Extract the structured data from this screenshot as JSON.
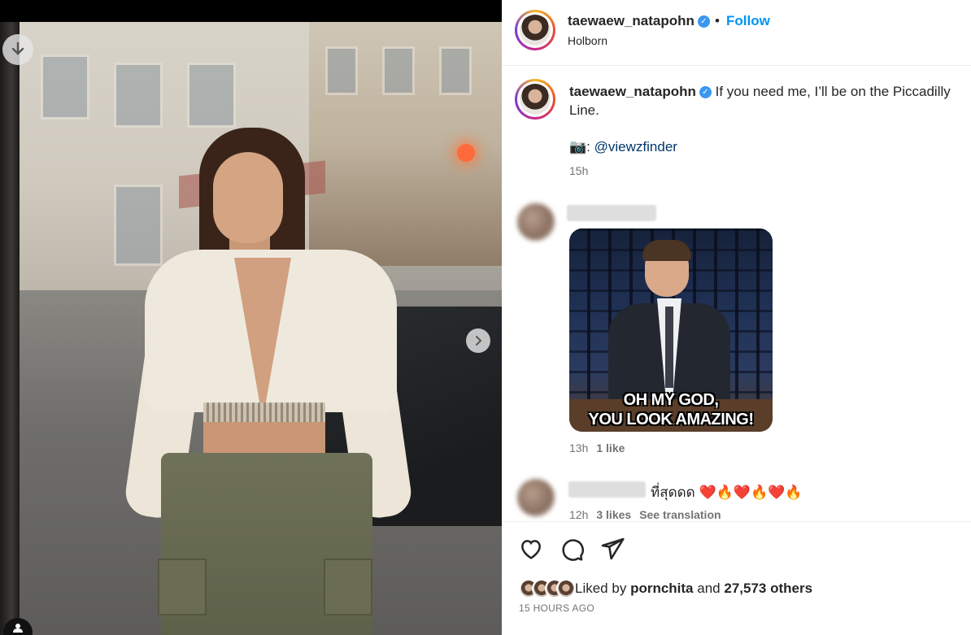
{
  "post": {
    "username": "taewaew_natapohn",
    "location": "Holborn",
    "follow_label": "Follow",
    "separator": "•",
    "verified_mark": "✓"
  },
  "caption": {
    "username": "taewaew_natapohn",
    "text": "If you need me, I’ll be on the Piccadilly Line.",
    "camera_icon": "📷",
    "credit_prefix": ":",
    "credit_handle": "@viewzfinder",
    "time": "15h"
  },
  "comments": [
    {
      "gif_caption_line1": "OH MY GOD,",
      "gif_caption_line2": "YOU LOOK AMAZING!",
      "time": "13h",
      "likes": "1 like"
    },
    {
      "text": "ที่สุดดด",
      "emojis": [
        "❤️",
        "🔥",
        "❤️",
        "🔥",
        "❤️",
        "🔥"
      ],
      "time": "12h",
      "likes": "3 likes",
      "see_translation": "See translation"
    }
  ],
  "footer": {
    "liked_by_prefix": "Liked by",
    "liked_by_user": "pornchita",
    "liked_by_and": "and",
    "liked_by_count": "27,573 others",
    "time_ago": "15 HOURS AGO"
  },
  "icons": {
    "download": "download-icon",
    "next": "chevron-right-icon",
    "user_tag": "user-tag-icon",
    "like": "heart-icon",
    "comment": "comment-icon",
    "share": "share-icon"
  },
  "colors": {
    "accent": "#0095f6",
    "verified": "#3897f0",
    "muted": "#737373",
    "link": "#00376b"
  }
}
